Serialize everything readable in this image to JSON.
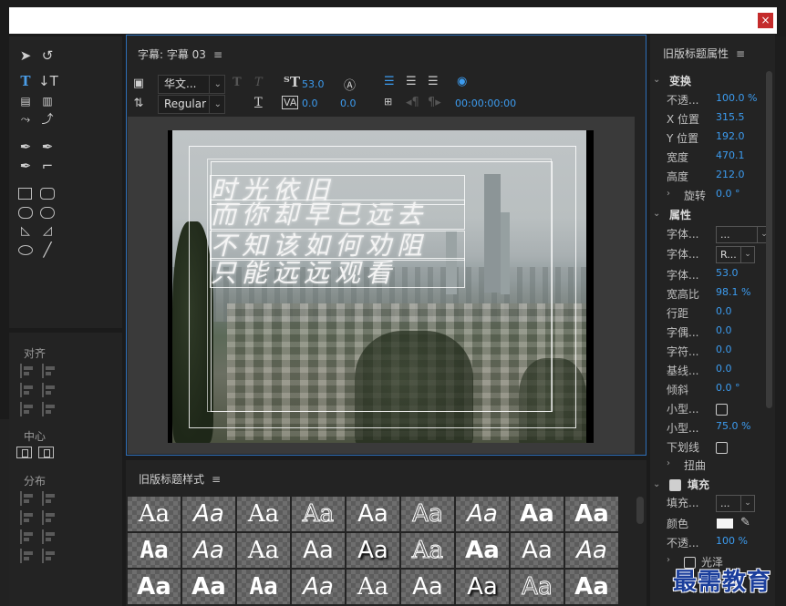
{
  "window": {
    "close_glyph": "×"
  },
  "tools": {
    "icons": [
      "select-tool",
      "rotate-tool",
      "type-tool",
      "vertical-type-tool",
      "area-type-tool",
      "vertical-area-type-tool",
      "path-type-tool",
      "vertical-path-type-tool",
      "pen-tool",
      "delete-anchor-tool",
      "add-anchor-tool",
      "convert-anchor-tool",
      "rectangle-tool",
      "rounded-rect-tool",
      "clipped-rect-tool",
      "rounded-corner-tool",
      "wedge-tool",
      "arc-tool",
      "ellipse-tool",
      "line-tool"
    ]
  },
  "align": {
    "title": "对齐",
    "center_title": "中心",
    "distribute_title": "分布"
  },
  "editor": {
    "tab_label": "字幕: 字幕 03",
    "font_family": "华文...",
    "font_style": "Regular",
    "font_size": "53.0",
    "kerning": "0.0",
    "leading": "0.0",
    "timecode": "00:00:00:00",
    "subtitle_lines": [
      "时光依旧",
      "而你却早已远去",
      "不知该如何劝阻",
      "只能远远观看"
    ]
  },
  "styles": {
    "title": "旧版标题样式",
    "sample": "Aa",
    "count": 27
  },
  "properties": {
    "title": "旧版标题属性",
    "transform": {
      "title": "变换",
      "opacity_label": "不透...",
      "opacity": "100.0 %",
      "x_label": "X 位置",
      "x": "315.5",
      "y_label": "Y 位置",
      "y": "192.0",
      "width_label": "宽度",
      "width": "470.1",
      "height_label": "高度",
      "height": "212.0",
      "rotation_label": "旋转",
      "rotation": "0.0 °"
    },
    "attributes": {
      "title": "属性",
      "font_family_label": "字体...",
      "font_family": "...",
      "font_style_label": "字体...",
      "font_style": "R...",
      "font_size_label": "字体...",
      "font_size": "53.0",
      "aspect_label": "宽高比",
      "aspect": "98.1 %",
      "leading_label": "行距",
      "leading": "0.0",
      "kerning_label": "字偶...",
      "kerning": "0.0",
      "tracking_label": "字符...",
      "tracking": "0.0",
      "baseline_label": "基线...",
      "baseline": "0.0",
      "slant_label": "倾斜",
      "slant": "0.0 °",
      "smallcaps_label": "小型...",
      "smallcaps_size_label": "小型...",
      "smallcaps_size": "75.0 %",
      "underline_label": "下划线",
      "distort_label": "扭曲"
    },
    "fill": {
      "title": "填充",
      "type_label": "填充...",
      "type": "...",
      "color_label": "颜色",
      "color": "#f4f4f4",
      "opacity_label": "不透...",
      "opacity": "100 %",
      "sheen_label": "光泽"
    }
  },
  "watermark": "最需教育"
}
